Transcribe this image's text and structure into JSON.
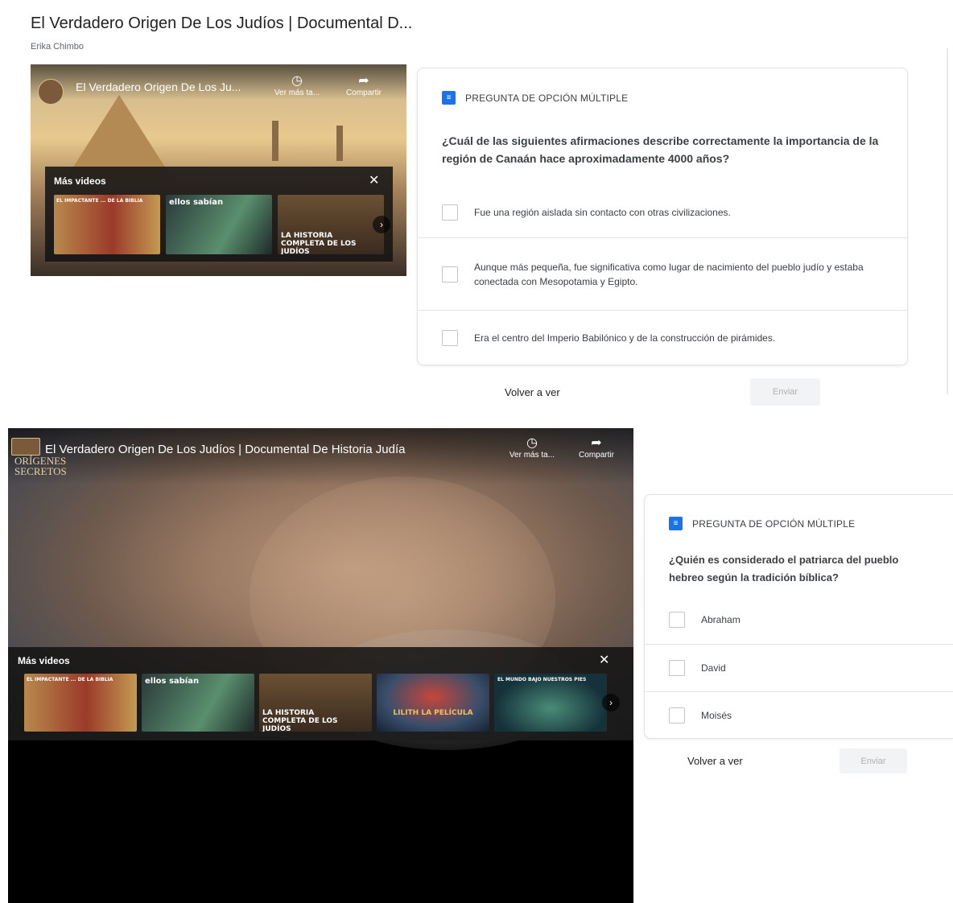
{
  "panel1": {
    "video_title": "El Verdadero Origen De Los Judíos | Documental D...",
    "author": "Erika Chimbo",
    "player": {
      "overlay_title": "El Verdadero Origen De Los Ju...",
      "watch_later": "Ver más ta...",
      "share": "Compartir",
      "more_videos_label": "Más videos",
      "close_icon": "close-icon",
      "thumbnails": [
        {
          "text": "EL IMPACTANTE ... DE LA BIBLIA"
        },
        {
          "text": "ellos sabían"
        },
        {
          "text": "LA HISTORIA COMPLETA DE LOS JUDÍOS"
        }
      ]
    },
    "quiz": {
      "type_label": "PREGUNTA DE OPCIÓN MÚLTIPLE",
      "question": "¿Cuál de las siguientes afirmaciones describe correctamente la importancia de la región de Canaán hace aproximadamente 4000 años?",
      "options": [
        {
          "label": "Fue una región aislada sin contacto con otras civilizaciones."
        },
        {
          "label": "Aunque más pequeña, fue significativa como lugar de nacimiento del pueblo judío y estaba conectada con Mesopotamia y Egipto."
        },
        {
          "label": "Era el centro del Imperio Babilónico y de la construcción de pirámides."
        }
      ],
      "replay_label": "Volver a ver",
      "send_label": "Enviar"
    }
  },
  "panel2": {
    "player": {
      "overlay_title": "El Verdadero Origen De Los Judíos | Documental De Historia Judía",
      "channel_name_line1": "ORÍGENES",
      "channel_name_line2": "SECRETOS",
      "watch_later": "Ver más ta...",
      "share": "Compartir",
      "more_videos_label": "Más videos",
      "thumbnails": [
        {
          "text": "EL IMPACTANTE ... DE LA BIBLIA"
        },
        {
          "text": "ellos sabían"
        },
        {
          "text": "LA HISTORIA COMPLETA DE LOS JUDÍOS"
        },
        {
          "text": "LILITH LA PELÍCULA"
        },
        {
          "text": "EL MUNDO BAJO NUESTROS PIES"
        }
      ]
    },
    "quiz": {
      "type_label": "PREGUNTA DE OPCIÓN MÚLTIPLE",
      "question": "¿Quién es considerado el patriarca del pueblo hebreo según la tradición bíblica?",
      "options": [
        {
          "label": "Abraham"
        },
        {
          "label": "David"
        },
        {
          "label": "Moisés"
        }
      ],
      "replay_label": "Volver a ver",
      "send_label": "Enviar"
    }
  }
}
